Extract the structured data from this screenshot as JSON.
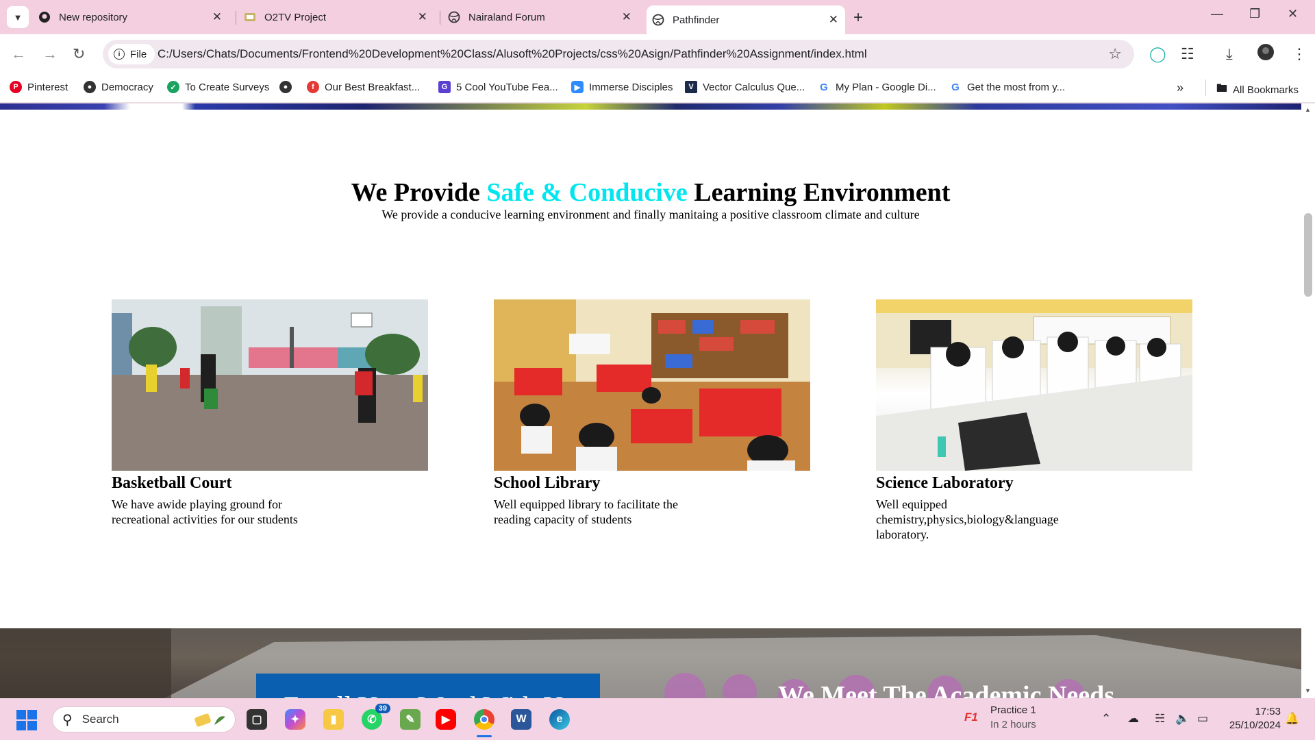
{
  "tabs": [
    {
      "title": "New repository",
      "favicon": "github-icon"
    },
    {
      "title": "O2TV Project",
      "favicon": "o2tv-icon"
    },
    {
      "title": "Nairaland Forum",
      "favicon": "globe-icon"
    },
    {
      "title": "Pathfinder",
      "favicon": "globe-icon",
      "active": true
    }
  ],
  "toolbar": {
    "file_label": "File",
    "url": "C:/Users/Chats/Documents/Frontend%20Development%20Class/Alusoft%20Projects/css%20Asign/Pathfinder%20Assignment/index.html"
  },
  "bookmarks": [
    {
      "label": "Pinterest",
      "icon": "pinterest-icon",
      "color": "#e60023"
    },
    {
      "label": "Democracy",
      "icon": "globe-icon",
      "color": "#333333"
    },
    {
      "label": "To Create Surveys",
      "icon": "survey-icon",
      "color": "#1aa260"
    },
    {
      "label": "",
      "icon": "globe-icon",
      "color": "#333333"
    },
    {
      "label": "Our Best Breakfast...",
      "icon": "food-icon",
      "color": "#e53935"
    },
    {
      "label": "5 Cool YouTube Fea...",
      "icon": "gt-icon",
      "color": "#5b3fd1"
    },
    {
      "label": "Immerse Disciples",
      "icon": "zoom-icon",
      "color": "#2d8cff"
    },
    {
      "label": "Vector Calculus Que...",
      "icon": "book-icon",
      "color": "#1b2a4a"
    },
    {
      "label": "My Plan - Google Di...",
      "icon": "google-icon",
      "color": "#4285f4"
    },
    {
      "label": "Get the most from y...",
      "icon": "google-icon",
      "color": "#4285f4"
    }
  ],
  "all_bookmarks": "All Bookmarks",
  "page": {
    "title_before": "We Provide ",
    "title_accent": "Safe & Conducive",
    "title_after": " Learning Environment",
    "accent_color": "#00e5ee",
    "subtitle": "We provide a conducive learning environment and finally manitaing a positive classroom climate and culture",
    "cards": [
      {
        "heading": "Basketball Court",
        "text": "We have awide playing ground for recreational activities for our students"
      },
      {
        "heading": "School Library",
        "text": "Well equipped library to facilitate the reading capacity of students"
      },
      {
        "heading": "Science Laboratory",
        "text": "Well equipped chemistry,physics,biology&language laboratory."
      }
    ],
    "enroll_text": "Enroll Your Ward With Us",
    "meet_text": "We Meet The Academic Needs"
  },
  "taskbar": {
    "search_label": "Search",
    "whatsapp_badge": "39",
    "notif_title": "Practice 1",
    "notif_sub": "In 2 hours",
    "time": "17:53",
    "date": "25/10/2024"
  }
}
